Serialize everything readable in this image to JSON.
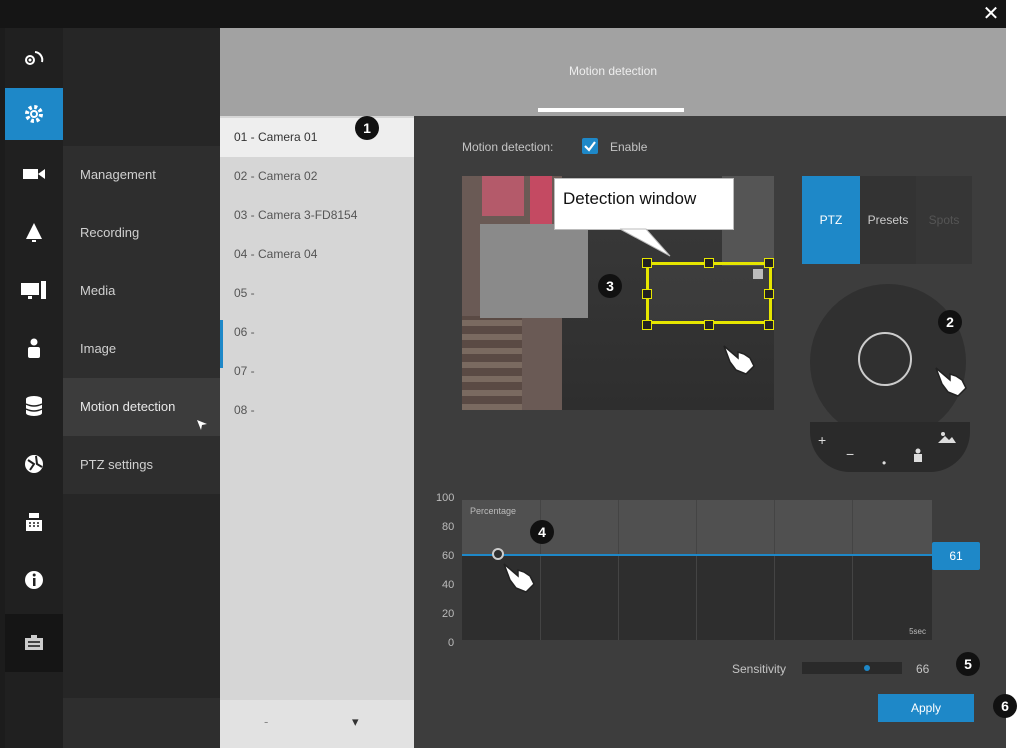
{
  "window": {
    "close_label": "✕"
  },
  "iconbar": {
    "items": [
      "camera-control-icon",
      "settings-icon",
      "video-camera-icon",
      "alarm-bell-icon",
      "monitor-display-icon",
      "user-icon",
      "database-icon",
      "network-globe-icon",
      "cash-register-icon",
      "info-icon",
      "keyboard-icon"
    ]
  },
  "header": {
    "title": "Motion detection"
  },
  "categories": [
    "Management",
    "Recording",
    "Media",
    "Image",
    "Motion detection",
    "PTZ settings"
  ],
  "cameras": [
    "01 - Camera 01",
    "02 - Camera 02",
    "03 - Camera 3-FD8154",
    "04 - Camera 04",
    "05 -",
    "06 -",
    "07 -",
    "08 -"
  ],
  "camlist_nav": {
    "prev": "-",
    "next": "▾"
  },
  "motion": {
    "label": "Motion detection:",
    "enable_label": "Enable",
    "enabled": true
  },
  "callout": {
    "text": "Detection window"
  },
  "ptz": {
    "tabs": [
      "PTZ",
      "Presets",
      "Spots"
    ],
    "zoom_in": "+",
    "zoom_out": "−",
    "dot": "•"
  },
  "chart": {
    "axis_label": "Percentage",
    "corner_label": "5sec",
    "ticks": [
      "100",
      "80",
      "60",
      "40",
      "20",
      "0"
    ],
    "threshold_value": "61"
  },
  "chart_data": {
    "type": "line",
    "ylabel": "Percentage",
    "ylim": [
      0,
      100
    ],
    "series": [
      {
        "values": [
          61,
          61
        ]
      }
    ]
  },
  "sensitivity": {
    "label": "Sensitivity",
    "value": "66",
    "level": 0.66
  },
  "apply_label": "Apply",
  "markers": [
    "1",
    "2",
    "3",
    "4",
    "5",
    "6"
  ],
  "colors": {
    "accent": "#1e88c8",
    "detection_window": "#e6e600"
  }
}
